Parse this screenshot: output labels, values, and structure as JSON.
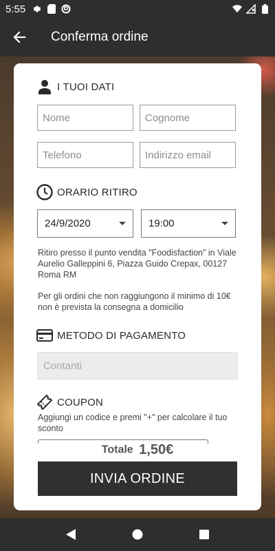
{
  "status_bar": {
    "time": "5:55",
    "icons": [
      "settings-icon",
      "sim-card-icon",
      "data-saver-icon"
    ],
    "right_icons": [
      "wifi-icon",
      "no-signal-icon",
      "battery-icon"
    ]
  },
  "app_bar": {
    "title": "Conferma ordine",
    "back_icon": "arrow-back-icon"
  },
  "personal_data": {
    "heading": "I TUOI DATI",
    "icon": "person-icon",
    "fields": {
      "first_name": {
        "placeholder": "Nome",
        "value": ""
      },
      "last_name": {
        "placeholder": "Cognome",
        "value": ""
      },
      "phone": {
        "placeholder": "Telefono",
        "value": ""
      },
      "email": {
        "placeholder": "Indirizzo email",
        "value": ""
      }
    }
  },
  "pickup": {
    "heading": "ORARIO RITIRO",
    "icon": "clock-icon",
    "date": "24/9/2020",
    "time": "19:00",
    "address_note": "Ritiro presso il punto vendita \"Foodisfaction\" in Viale Aurelio Galleppini 6, Piazza Guido Crepax, 00127 Roma RM",
    "minimum_note": "Per gli ordini che non raggiungono il minimo di 10€ non è prevista la consegna a domicilio"
  },
  "payment": {
    "heading": "METODO DI PAGAMENTO",
    "icon": "credit-card-icon",
    "method": "Contanti"
  },
  "coupon": {
    "heading": "COUPON",
    "icon": "ticket-icon",
    "hint": "Aggiungi un codice e premi \"+\" per calcolare il tuo sconto"
  },
  "summary": {
    "total_label": "Totale",
    "total_value": "1,50€"
  },
  "submit_label": "INVIA ORDINE",
  "nav": {
    "back": "nav-back-icon",
    "home": "nav-home-icon",
    "recents": "nav-recents-icon"
  }
}
